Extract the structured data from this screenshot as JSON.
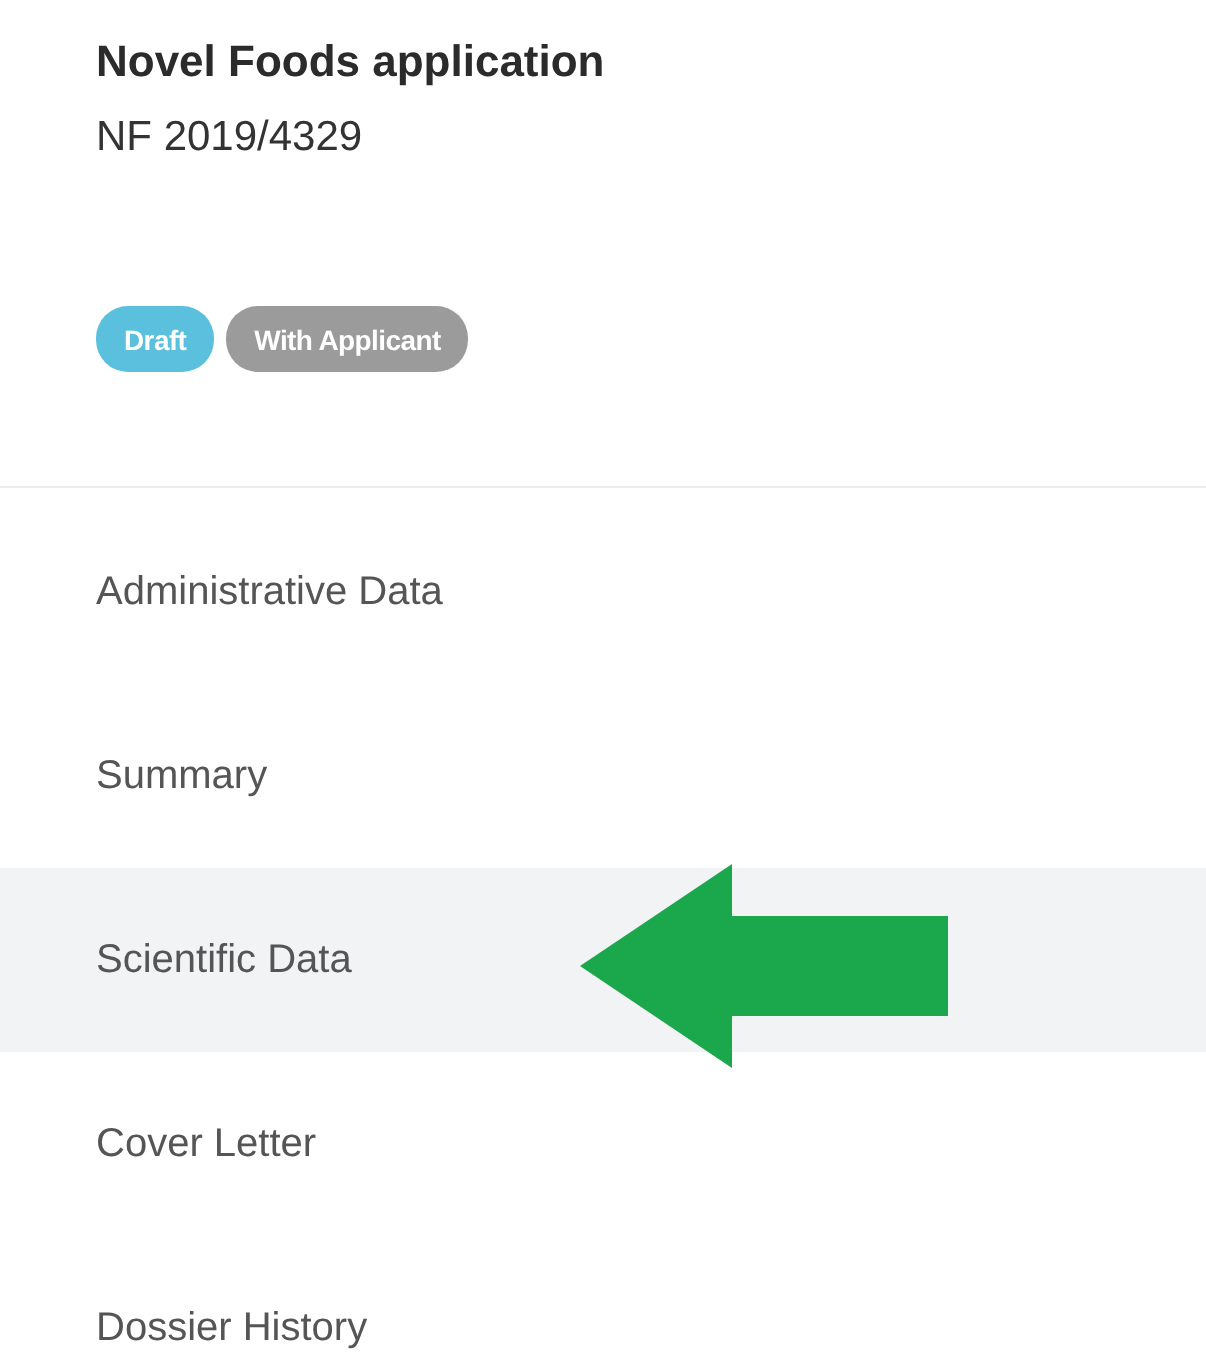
{
  "header": {
    "title": "Novel Foods application",
    "reference": "NF 2019/4329"
  },
  "badges": [
    {
      "label": "Draft",
      "color": "#5bc0de"
    },
    {
      "label": "With Applicant",
      "color": "#9b9b9b"
    }
  ],
  "menu": [
    {
      "label": "Administrative Data",
      "selected": false,
      "pointed": false
    },
    {
      "label": "Summary",
      "selected": false,
      "pointed": false
    },
    {
      "label": "Scientific Data",
      "selected": true,
      "pointed": true
    },
    {
      "label": "Cover Letter",
      "selected": false,
      "pointed": false
    },
    {
      "label": "Dossier History",
      "selected": false,
      "pointed": false
    }
  ]
}
